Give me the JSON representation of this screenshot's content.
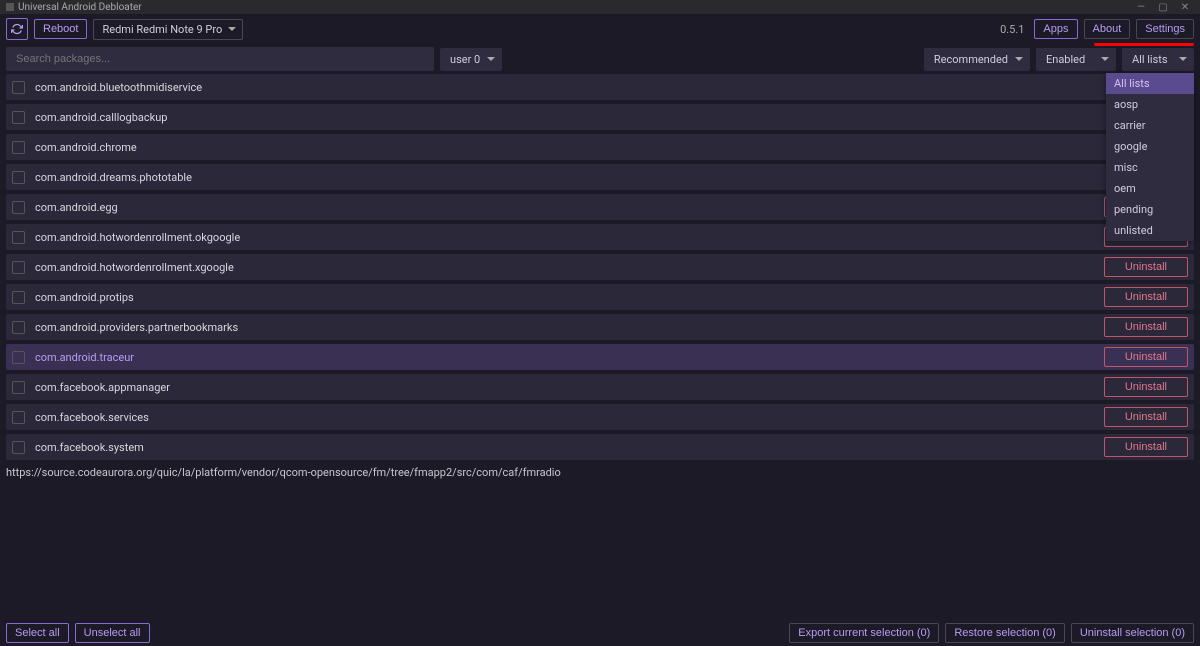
{
  "window": {
    "title": "Universal Android Debloater"
  },
  "topbar": {
    "reboot_label": "Reboot",
    "device": "Redmi Redmi Note 9 Pro",
    "version": "0.5.1",
    "nav": {
      "apps": "Apps",
      "about": "About",
      "settings": "Settings"
    }
  },
  "filter": {
    "search_placeholder": "Search packages...",
    "user": "user 0",
    "recommended": "Recommended",
    "enabled": "Enabled",
    "lists": "All lists"
  },
  "lists_dropdown": [
    "All lists",
    "aosp",
    "carrier",
    "google",
    "misc",
    "oem",
    "pending",
    "unlisted"
  ],
  "packages": [
    {
      "name": "com.android.bluetoothmidiservice",
      "action": false,
      "hl": false
    },
    {
      "name": "com.android.calllogbackup",
      "action": false,
      "hl": false
    },
    {
      "name": "com.android.chrome",
      "action": false,
      "hl": false
    },
    {
      "name": "com.android.dreams.phototable",
      "action": false,
      "hl": false
    },
    {
      "name": "com.android.egg",
      "action": true,
      "hl": false
    },
    {
      "name": "com.android.hotwordenrollment.okgoogle",
      "action": true,
      "hl": false
    },
    {
      "name": "com.android.hotwordenrollment.xgoogle",
      "action": true,
      "hl": false
    },
    {
      "name": "com.android.protips",
      "action": true,
      "hl": false
    },
    {
      "name": "com.android.providers.partnerbookmarks",
      "action": true,
      "hl": false
    },
    {
      "name": "com.android.traceur",
      "action": true,
      "hl": true
    },
    {
      "name": "com.facebook.appmanager",
      "action": true,
      "hl": false
    },
    {
      "name": "com.facebook.services",
      "action": true,
      "hl": false
    },
    {
      "name": "com.facebook.system",
      "action": true,
      "hl": false
    }
  ],
  "action_label": "Uninstall",
  "info_url": "https://source.codeaurora.org/quic/la/platform/vendor/qcom-opensource/fm/tree/fmapp2/src/com/caf/fmradio",
  "bottom": {
    "select_all": "Select all",
    "unselect_all": "Unselect all",
    "export": "Export current selection (0)",
    "restore": "Restore selection (0)",
    "uninstall": "Uninstall selection (0)"
  }
}
